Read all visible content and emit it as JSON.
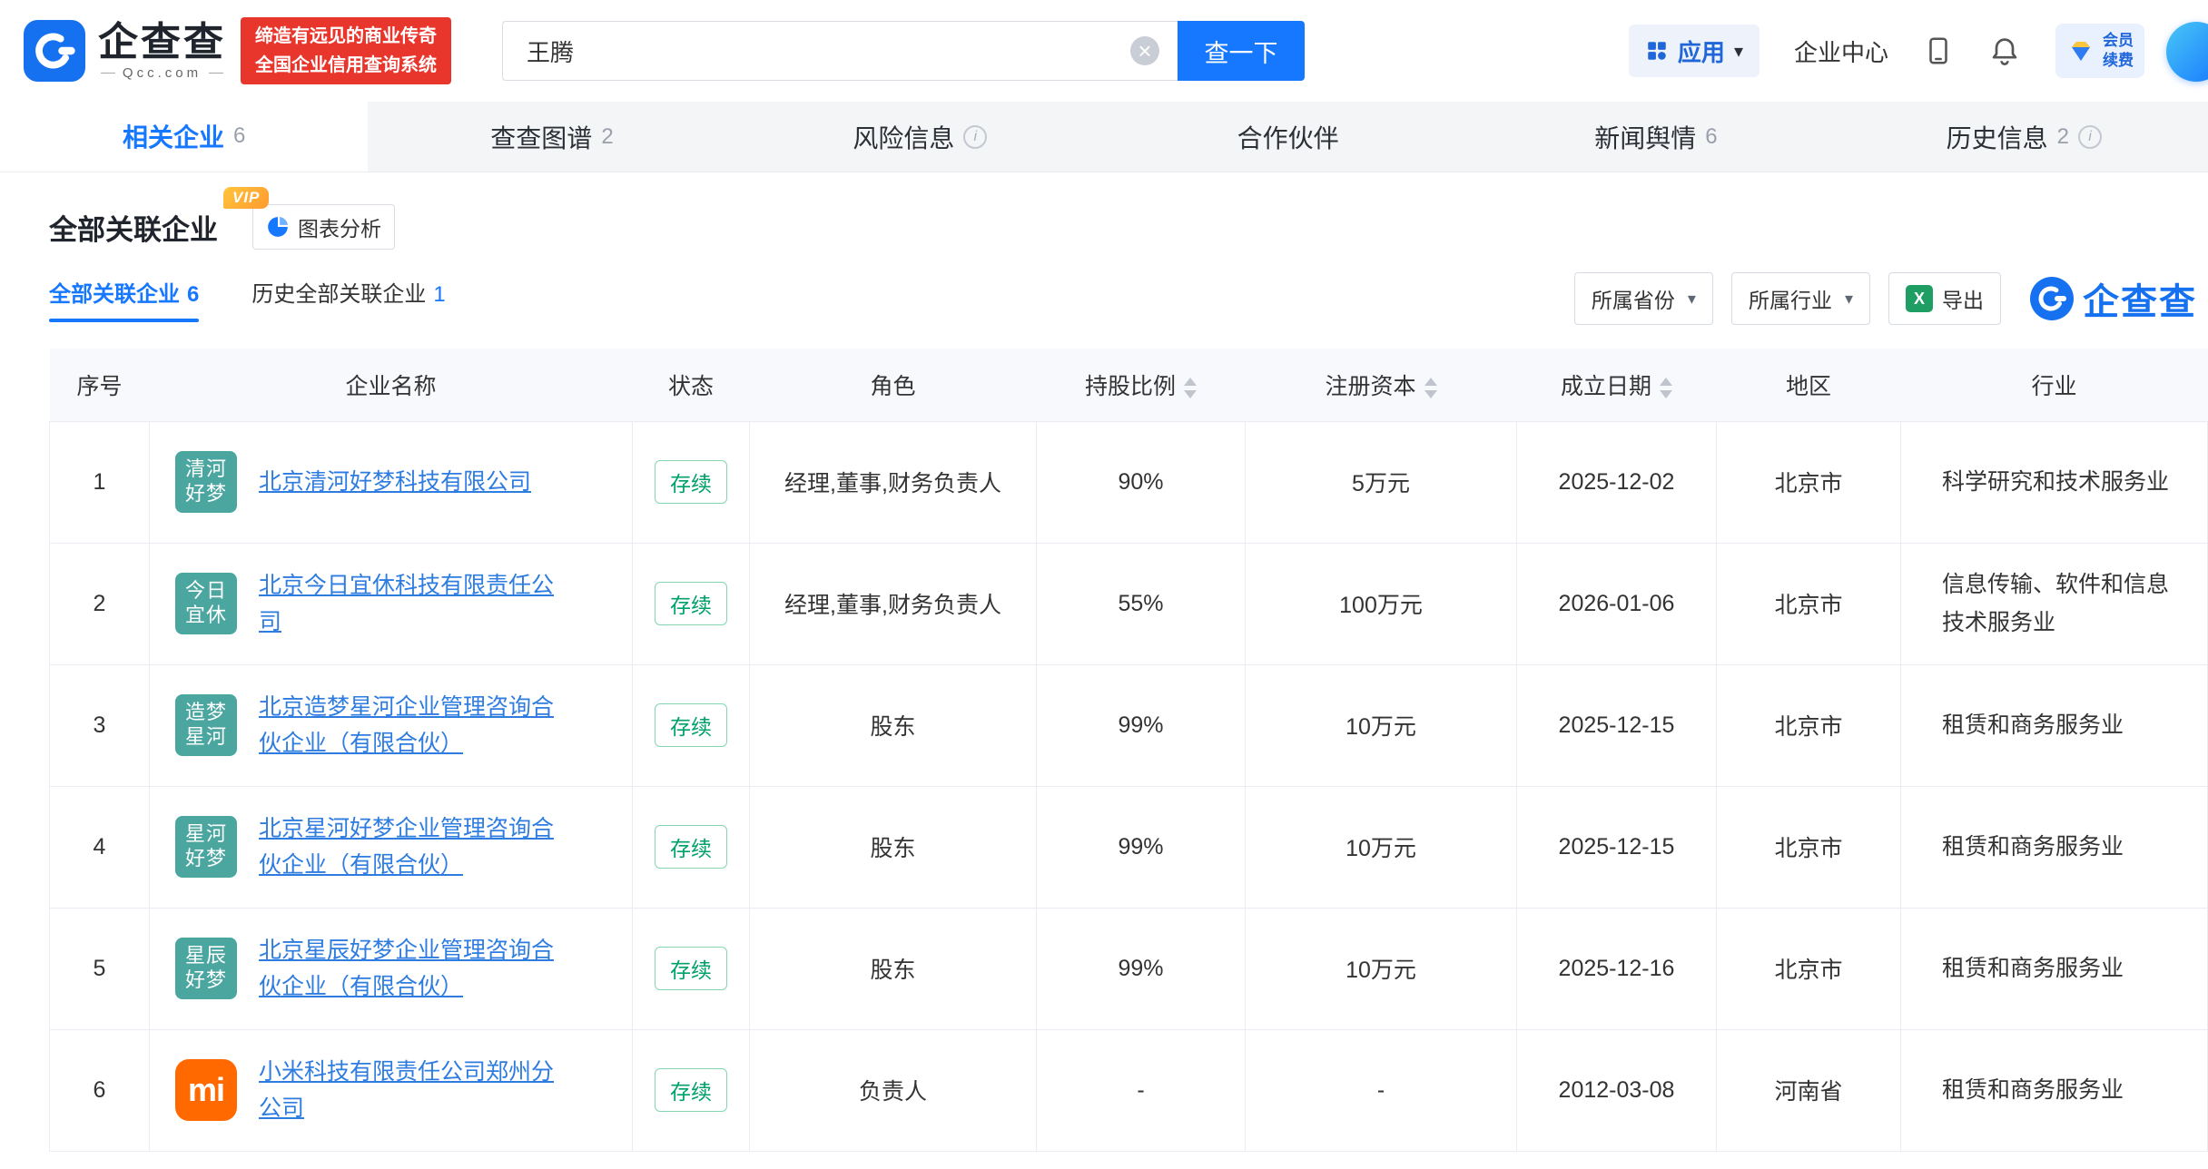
{
  "brand": {
    "name": "企查查",
    "domain": "Qcc.com",
    "slogan_line1": "缔造有远见的商业传奇",
    "slogan_line2": "全国企业信用查询系统"
  },
  "header": {
    "search_value": "王腾",
    "search_button": "查一下",
    "apps_label": "应用",
    "enterprise_center": "企业中心",
    "vip_line1": "会员",
    "vip_line2": "续费"
  },
  "tabs": [
    {
      "label": "相关企业",
      "count": "6"
    },
    {
      "label": "查查图谱",
      "count": "2"
    },
    {
      "label": "风险信息",
      "count": ""
    },
    {
      "label": "合作伙伴",
      "count": ""
    },
    {
      "label": "新闻舆情",
      "count": "6"
    },
    {
      "label": "历史信息",
      "count": "2"
    }
  ],
  "section": {
    "title": "全部关联企业",
    "vip_badge": "VIP",
    "chart_analysis": "图表分析",
    "subtab_active_label": "全部关联企业",
    "subtab_active_count": "6",
    "subtab_history_label": "历史全部关联企业",
    "subtab_history_count": "1",
    "filter_province": "所属省份",
    "filter_industry": "所属行业",
    "export_label": "导出",
    "corner_logo_text": "企查查"
  },
  "table": {
    "columns": [
      {
        "label": "序号"
      },
      {
        "label": "企业名称"
      },
      {
        "label": "状态"
      },
      {
        "label": "角色"
      },
      {
        "label": "持股比例"
      },
      {
        "label": "注册资本"
      },
      {
        "label": "成立日期"
      },
      {
        "label": "地区"
      },
      {
        "label": "行业"
      }
    ],
    "rows": [
      {
        "no": "1",
        "logo_line1": "清河",
        "logo_line2": "好梦",
        "name": "北京清河好梦科技有限公司",
        "status": "存续",
        "role": "经理,董事,财务负责人",
        "share": "90%",
        "capital": "5万元",
        "date": "2025-12-02",
        "region": "北京市",
        "industry": "科学研究和技术服务业"
      },
      {
        "no": "2",
        "logo_line1": "今日",
        "logo_line2": "宜休",
        "name": "北京今日宜休科技有限责任公司",
        "status": "存续",
        "role": "经理,董事,财务负责人",
        "share": "55%",
        "capital": "100万元",
        "date": "2026-01-06",
        "region": "北京市",
        "industry": "信息传输、软件和信息技术服务业"
      },
      {
        "no": "3",
        "logo_line1": "造梦",
        "logo_line2": "星河",
        "name": "北京造梦星河企业管理咨询合伙企业（有限合伙）",
        "status": "存续",
        "role": "股东",
        "share": "99%",
        "capital": "10万元",
        "date": "2025-12-15",
        "region": "北京市",
        "industry": "租赁和商务服务业"
      },
      {
        "no": "4",
        "logo_line1": "星河",
        "logo_line2": "好梦",
        "name": "北京星河好梦企业管理咨询合伙企业（有限合伙）",
        "status": "存续",
        "role": "股东",
        "share": "99%",
        "capital": "10万元",
        "date": "2025-12-15",
        "region": "北京市",
        "industry": "租赁和商务服务业"
      },
      {
        "no": "5",
        "logo_line1": "星辰",
        "logo_line2": "好梦",
        "name": "北京星辰好梦企业管理咨询合伙企业（有限合伙）",
        "status": "存续",
        "role": "股东",
        "share": "99%",
        "capital": "10万元",
        "date": "2025-12-16",
        "region": "北京市",
        "industry": "租赁和商务服务业"
      },
      {
        "no": "6",
        "logo_text": "mi",
        "name": "小米科技有限责任公司郑州分公司",
        "status": "存续",
        "role": "负责人",
        "share": "-",
        "capital": "-",
        "date": "2012-03-08",
        "region": "河南省",
        "industry": "租赁和商务服务业"
      }
    ]
  },
  "colors": {
    "brand_blue": "#1677ff",
    "link_blue": "#2e7ce0",
    "status_green": "#00a06b",
    "logo_teal": "#4ba6a0",
    "xiaomi_orange": "#ff6900",
    "slogan_red": "#e8362d"
  }
}
